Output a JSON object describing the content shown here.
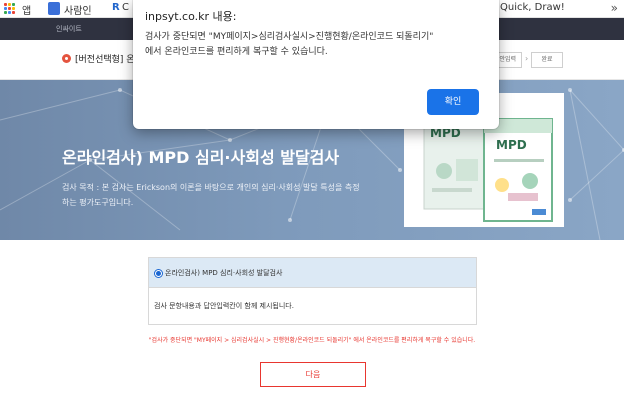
{
  "bookmarks": {
    "apps_label": "앱",
    "items": [
      "사람인",
      "C"
    ],
    "right_label": "Quick, Draw!",
    "more": "»"
  },
  "topnav": {
    "link": "인싸이트"
  },
  "breadcrumb": {
    "title": "[버전선택형] 온라",
    "steps": [
      "답안입력",
      "완료"
    ]
  },
  "hero": {
    "title": "온라인검사) MPD 심리·사회성 발달검사",
    "description": "검사 목적 : 본 검사는 Erickson의 이론을 바탕으로 개인의 심리·사회성 발달 특성을 측정하는 평가도구입니다.",
    "book_label": "MPD"
  },
  "option": {
    "label": "온라인검사) MPD 심리·사회성 발달검사",
    "text": "검사 문항내용과 답안입력칸이 함께 제시됩니다."
  },
  "notice": "\"검사가 중단되면 \"MY페이지 > 심리검사실시 > 진행현황/온라인코드 되돌리기\" 에서 온라인코드를 편리하게 복구할 수 있습니다.",
  "next_button": "다음",
  "dialog": {
    "title": "inpsyt.co.kr 내용:",
    "message": "검사가 중단되면 \"MY페이지>심리검사실시>진행현황/온라인코드 되돌리기\" 에서 온라인코드를 편리하게 복구할 수 있습니다.",
    "ok": "확인"
  },
  "colors": {
    "accent_red": "#e8362f",
    "dialog_button": "#1a73e8",
    "nav_bg": "#2f3240",
    "hero_bg": "#7e9abb"
  }
}
